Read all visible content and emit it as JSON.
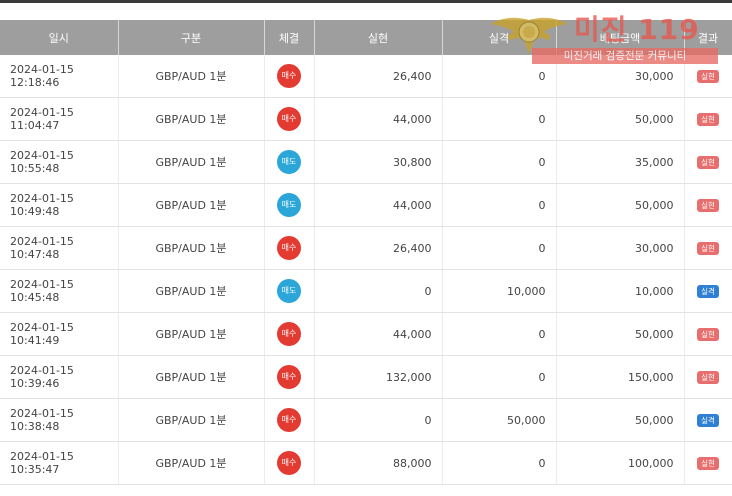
{
  "table": {
    "headers": [
      "일시",
      "구분",
      "체결",
      "실현",
      "실격",
      "배팅금액",
      "결과"
    ],
    "rows": [
      {
        "date": "2024-01-15 12:18:46",
        "category": "GBP/AUD 1분",
        "side": "매수",
        "side_type": "buy",
        "realized": "26,400",
        "loss": "0",
        "bet": "30,000",
        "result": "실현",
        "result_type": "win"
      },
      {
        "date": "2024-01-15 11:04:47",
        "category": "GBP/AUD 1분",
        "side": "매수",
        "side_type": "buy",
        "realized": "44,000",
        "loss": "0",
        "bet": "50,000",
        "result": "실현",
        "result_type": "win"
      },
      {
        "date": "2024-01-15 10:55:48",
        "category": "GBP/AUD 1분",
        "side": "매도",
        "side_type": "sell",
        "realized": "30,800",
        "loss": "0",
        "bet": "35,000",
        "result": "실현",
        "result_type": "win"
      },
      {
        "date": "2024-01-15 10:49:48",
        "category": "GBP/AUD 1분",
        "side": "매도",
        "side_type": "sell",
        "realized": "44,000",
        "loss": "0",
        "bet": "50,000",
        "result": "실현",
        "result_type": "win"
      },
      {
        "date": "2024-01-15 10:47:48",
        "category": "GBP/AUD 1분",
        "side": "매수",
        "side_type": "buy",
        "realized": "26,400",
        "loss": "0",
        "bet": "30,000",
        "result": "실현",
        "result_type": "win"
      },
      {
        "date": "2024-01-15 10:45:48",
        "category": "GBP/AUD 1분",
        "side": "매도",
        "side_type": "sell",
        "realized": "0",
        "loss": "10,000",
        "bet": "10,000",
        "result": "실격",
        "result_type": "loss"
      },
      {
        "date": "2024-01-15 10:41:49",
        "category": "GBP/AUD 1분",
        "side": "매수",
        "side_type": "buy",
        "realized": "44,000",
        "loss": "0",
        "bet": "50,000",
        "result": "실현",
        "result_type": "win"
      },
      {
        "date": "2024-01-15 10:39:46",
        "category": "GBP/AUD 1분",
        "side": "매수",
        "side_type": "buy",
        "realized": "132,000",
        "loss": "0",
        "bet": "150,000",
        "result": "실현",
        "result_type": "win"
      },
      {
        "date": "2024-01-15 10:38:48",
        "category": "GBP/AUD 1분",
        "side": "매수",
        "side_type": "buy",
        "realized": "0",
        "loss": "50,000",
        "bet": "50,000",
        "result": "실격",
        "result_type": "loss"
      },
      {
        "date": "2024-01-15 10:35:47",
        "category": "GBP/AUD 1분",
        "side": "매수",
        "side_type": "buy",
        "realized": "88,000",
        "loss": "0",
        "bet": "100,000",
        "result": "실현",
        "result_type": "win"
      }
    ]
  },
  "watermark": {
    "title": "미진 119",
    "subtitle": "미진거래 검증전문 커뮤니티"
  },
  "colors": {
    "header_bg": "#9e9e9e",
    "buy": "#e33a32",
    "sell": "#2aa6d8",
    "win_tag": "#e86e6e",
    "loss_tag": "#2f7fd4",
    "watermark": "#e8574e"
  }
}
